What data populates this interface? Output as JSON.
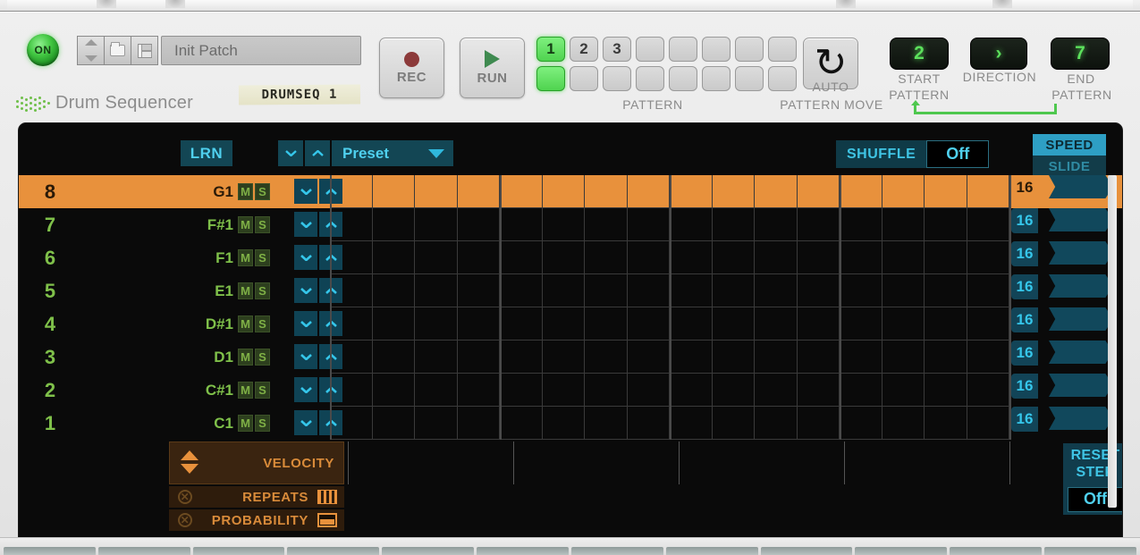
{
  "header": {
    "power_label": "ON",
    "patch_name": "Init Patch",
    "device_title": "Drum Sequencer",
    "tape_label": "DRUMSEQ 1",
    "nav_up_icon": "triangle-up-icon",
    "nav_down_icon": "triangle-down-icon",
    "folder_icon": "folder-icon",
    "save_icon": "floppy-save-icon"
  },
  "transport": {
    "rec_label": "REC",
    "run_label": "RUN",
    "rec_icon": "record-dot-icon",
    "run_icon": "play-triangle-icon"
  },
  "pattern": {
    "caption": "PATTERN",
    "row1": [
      "1",
      "2",
      "3",
      "",
      "",
      "",
      "",
      ""
    ],
    "row1_active": [
      true,
      false,
      false,
      false,
      false,
      false,
      false,
      false
    ],
    "row2": [
      "",
      "",
      "",
      "",
      "",
      "",
      "",
      ""
    ],
    "row2_active": [
      true,
      false,
      false,
      false,
      false,
      false,
      false,
      false
    ]
  },
  "auto_move": {
    "icon": "loop-refresh-icon",
    "caption_line1": "AUTO",
    "caption_line2": "PATTERN MOVE",
    "start_value": "2",
    "start_caption_line1": "START",
    "start_caption_line2": "PATTERN",
    "direction_value": "›",
    "direction_caption": "DIRECTION",
    "end_value": "7",
    "end_caption_line1": "END",
    "end_caption_line2": "PATTERN"
  },
  "seq_toolbar": {
    "lrn_label": "LRN",
    "chevron_down_icon": "chevron-down-icon",
    "chevron_up_icon": "chevron-up-icon",
    "preset_label": "Preset",
    "preset_caret_icon": "caret-down-icon",
    "shuffle_label": "SHUFFLE",
    "shuffle_value": "Off",
    "speed_tab": "SPEED",
    "slide_tab": "SLIDE"
  },
  "tracks": [
    {
      "num": "8",
      "note": "G1",
      "mute": "M",
      "solo": "S",
      "steps": "16",
      "selected": true
    },
    {
      "num": "7",
      "note": "F#1",
      "mute": "M",
      "solo": "S",
      "steps": "16",
      "selected": false
    },
    {
      "num": "6",
      "note": "F1",
      "mute": "M",
      "solo": "S",
      "steps": "16",
      "selected": false
    },
    {
      "num": "5",
      "note": "E1",
      "mute": "M",
      "solo": "S",
      "steps": "16",
      "selected": false
    },
    {
      "num": "4",
      "note": "D#1",
      "mute": "M",
      "solo": "S",
      "steps": "16",
      "selected": false
    },
    {
      "num": "3",
      "note": "D1",
      "mute": "M",
      "solo": "S",
      "steps": "16",
      "selected": false
    },
    {
      "num": "2",
      "note": "C#1",
      "mute": "M",
      "solo": "S",
      "steps": "16",
      "selected": false
    },
    {
      "num": "1",
      "note": "C1",
      "mute": "M",
      "solo": "S",
      "steps": "16",
      "selected": false
    }
  ],
  "grid": {
    "columns": 16,
    "rows": 8,
    "group_size": 4,
    "filled_steps": []
  },
  "params": {
    "velocity_label": "VELOCITY",
    "velocity_icon": "up-down-arrows-icon",
    "repeats_label": "REPEATS",
    "repeats_icon": "bars-icon",
    "repeats_toggle_icon": "x-circle-icon",
    "probability_label": "PROBABILITY",
    "probability_icon": "rect-fill-icon",
    "probability_toggle_icon": "x-circle-icon"
  },
  "reset_step": {
    "line1": "RESET",
    "line2": "STEP",
    "value": "Off"
  },
  "colors": {
    "accent_orange": "#e8913c",
    "accent_cyan": "#35c6ea",
    "accent_green": "#7fc04a",
    "led_green": "#5ce05c",
    "panel_bg": "#e9e9e9",
    "seq_bg": "#0a0a0a"
  }
}
